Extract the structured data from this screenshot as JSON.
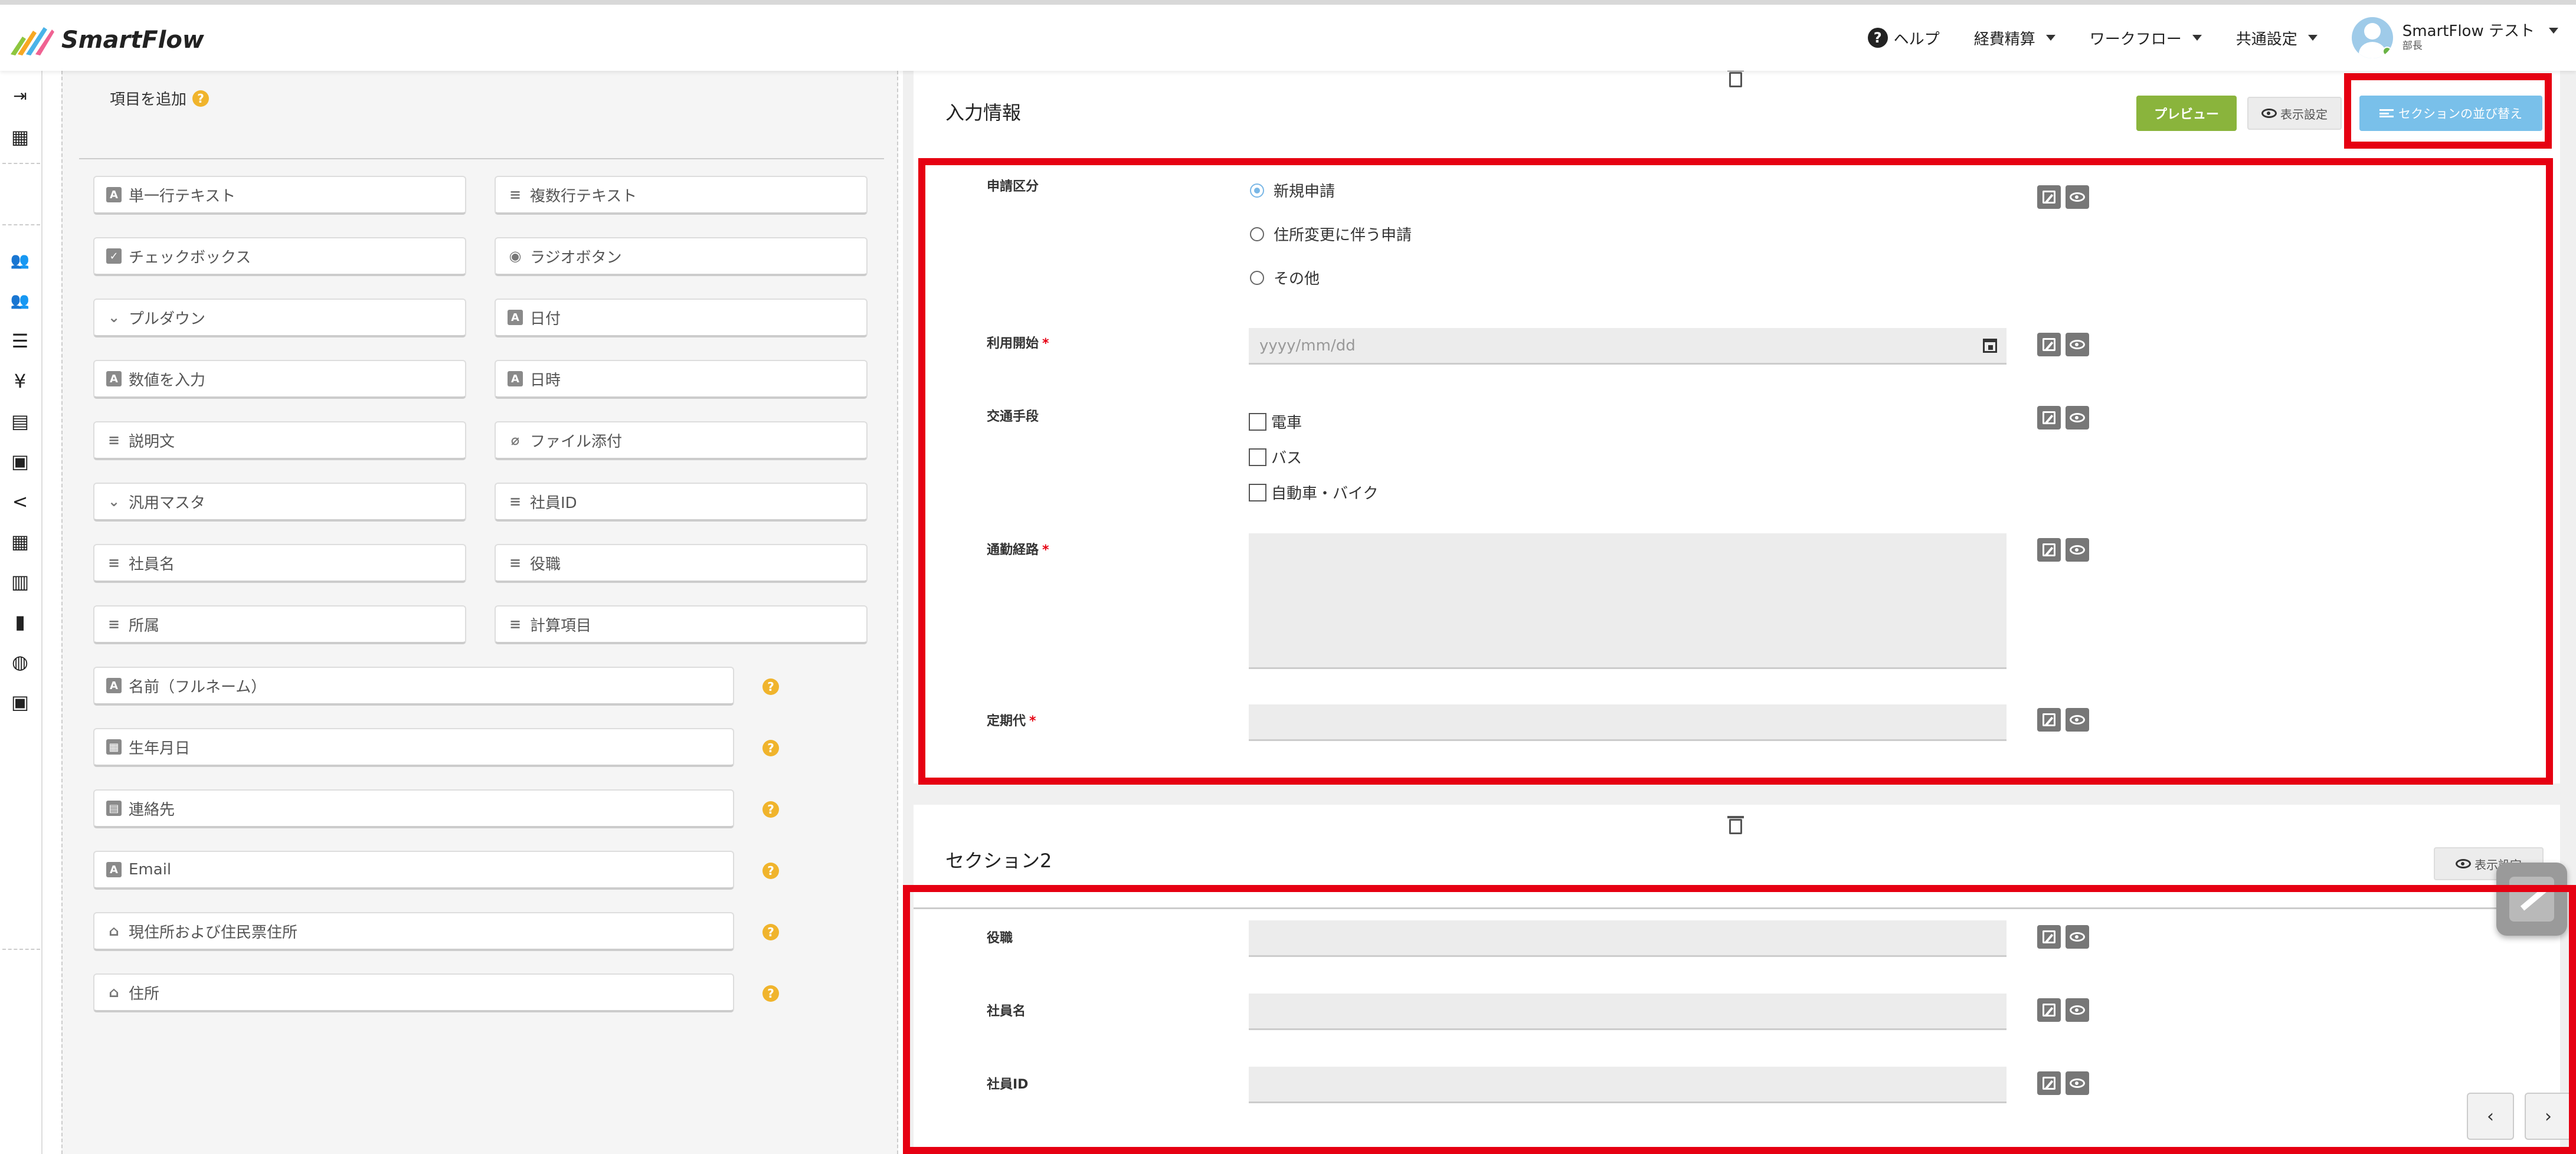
{
  "header": {
    "logo_text": "SmartFlow",
    "nav": {
      "help": "ヘルプ",
      "expense": "経費精算",
      "workflow": "ワークフロー",
      "common_settings": "共通設定",
      "user_name": "SmartFlow テスト",
      "user_dept": "部長"
    }
  },
  "sidebar": {
    "icons": [
      "collapse-icon",
      "building-icon",
      "users-icon",
      "group-icon",
      "list-icon",
      "yen-icon",
      "form-icon",
      "receipt-icon",
      "share-icon",
      "table-icon",
      "library-icon",
      "file-icon",
      "globe-icon",
      "wallet-icon"
    ]
  },
  "palette": {
    "title": "項目を追加",
    "items": [
      {
        "label": "単一行テキスト",
        "icon": "text-field-icon"
      },
      {
        "label": "複数行テキスト",
        "icon": "textarea-icon"
      },
      {
        "label": "チェックボックス",
        "icon": "checkbox-icon"
      },
      {
        "label": "ラジオボタン",
        "icon": "radio-icon"
      },
      {
        "label": "プルダウン",
        "icon": "dropdown-icon"
      },
      {
        "label": "日付",
        "icon": "date-icon"
      },
      {
        "label": "数値を入力",
        "icon": "number-icon"
      },
      {
        "label": "日時",
        "icon": "datetime-icon"
      },
      {
        "label": "説明文",
        "icon": "description-icon"
      },
      {
        "label": "ファイル添付",
        "icon": "attachment-icon"
      },
      {
        "label": "汎用マスタ",
        "icon": "master-icon"
      },
      {
        "label": "社員ID",
        "icon": "employee-id-icon"
      },
      {
        "label": "社員名",
        "icon": "employee-name-icon"
      },
      {
        "label": "役職",
        "icon": "position-icon"
      },
      {
        "label": "所属",
        "icon": "department-icon"
      },
      {
        "label": "計算項目",
        "icon": "calculation-icon"
      }
    ],
    "wide_items": [
      {
        "label": "名前（フルネーム）",
        "icon": "name-icon"
      },
      {
        "label": "生年月日",
        "icon": "birthday-icon"
      },
      {
        "label": "連絡先",
        "icon": "contact-icon"
      },
      {
        "label": "Email",
        "icon": "email-icon"
      },
      {
        "label": "現住所および住民票住所",
        "icon": "address-icon"
      },
      {
        "label": "住所",
        "icon": "address-icon"
      }
    ]
  },
  "section1": {
    "title": "入力情報",
    "preview_button": "プレビュー",
    "display_settings": "表示設定",
    "reorder_button": "セクションの並び替え",
    "fields": {
      "application_type": {
        "label": "申請区分",
        "options": [
          "新規申請",
          "住所変更に伴う申請",
          "その他"
        ],
        "selected": "新規申請"
      },
      "start_date": {
        "label": "利用開始",
        "required_mark": "*",
        "placeholder": "yyyy/mm/dd"
      },
      "transport": {
        "label": "交通手段",
        "options": [
          "電車",
          "バス",
          "自動車・バイク"
        ]
      },
      "route": {
        "label": "通勤経路",
        "required_mark": "*"
      },
      "pass_fee": {
        "label": "定期代",
        "required_mark": "*"
      }
    }
  },
  "section2": {
    "title": "セクション2",
    "display_settings": "表示設定",
    "fields": [
      "役職",
      "社員名",
      "社員ID"
    ]
  },
  "pagination": {
    "prev": "‹",
    "next": "›"
  },
  "colors": {
    "highlight": "#e60012",
    "preview": "#8ab43c",
    "reorder": "#79c0ea"
  }
}
